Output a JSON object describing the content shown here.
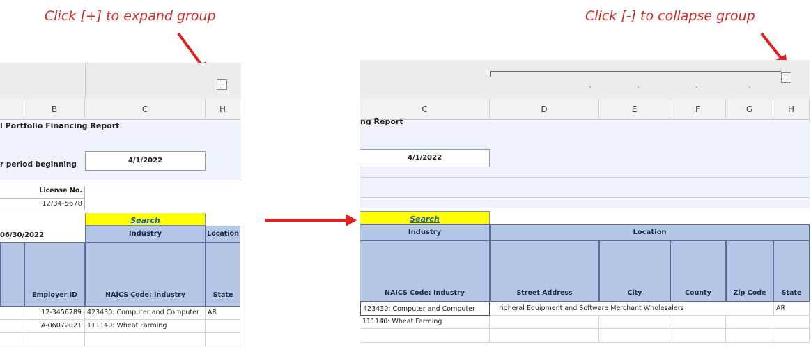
{
  "annotations": {
    "expand": "Click [+] to expand group",
    "collapse": "Click [-] to collapse group"
  },
  "left_panel": {
    "expand_button": "+",
    "column_headers": [
      "B",
      "C",
      "H"
    ],
    "report_title": "l Portfolio Financing Report",
    "period_label": "r period beginning",
    "period_date": "4/1/2022",
    "license_label": "License No.",
    "license_value": "12/34-5678",
    "search_label": "Search",
    "date_partial": "06/30/2022",
    "industry_header": "Industry",
    "location_header": "Location",
    "employer_id_header": "Employer ID",
    "naics_header": "NAICS Code: Industry",
    "state_header": "State",
    "rows": [
      {
        "employer_id": "12-3456789",
        "naics": "423430: Computer and Computer",
        "state": "AR"
      },
      {
        "employer_id": "A-06072021",
        "naics": "111140: Wheat Farming",
        "state": ""
      }
    ]
  },
  "right_panel": {
    "collapse_button": "−",
    "column_headers": [
      "C",
      "D",
      "E",
      "F",
      "G",
      "H"
    ],
    "report_title": "ng Report",
    "period_date": "4/1/2022",
    "search_label": "Search",
    "industry_header": "Industry",
    "location_header": "Location",
    "columns": [
      "NAICS Code: Industry",
      "Street Address",
      "City",
      "County",
      "Zip Code",
      "State"
    ],
    "rows": [
      {
        "naics": "423430: Computer and Computer",
        "overflow": "ripheral Equipment and Software Merchant Wholesalers",
        "state": "AR"
      },
      {
        "naics": "111140: Wheat Farming",
        "overflow": "",
        "state": ""
      }
    ]
  },
  "colors": {
    "annotation": "#d42a22",
    "header_blue": "#b4c7e7",
    "search_yellow": "#ffff00",
    "link_blue": "#1f5fb4"
  },
  "icons": [
    "arrow-down-icon",
    "arrow-right-icon"
  ]
}
